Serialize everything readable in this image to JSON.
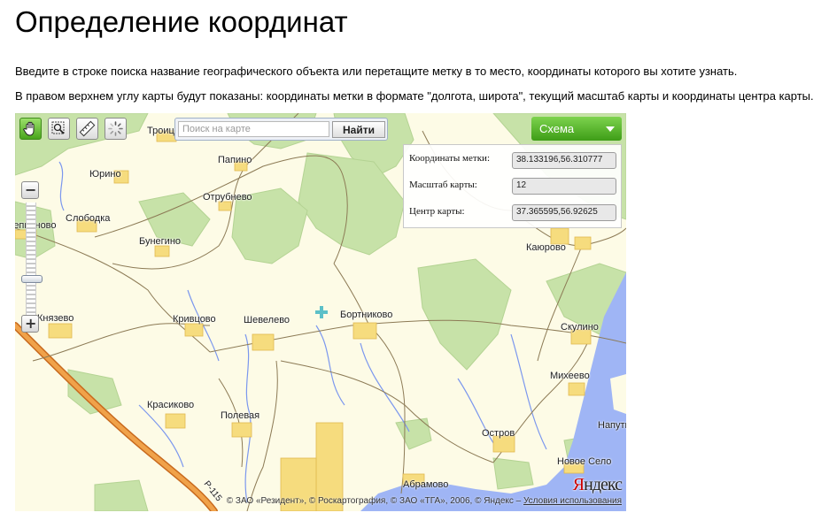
{
  "page": {
    "title": "Определение координат",
    "intro_1": "Введите в строке поиска название географического объекта или перетащите метку в то место, координаты которого вы хотите узнать.",
    "intro_2": "В правом верхнем углу карты будут показаны: координаты метки в формате \"долгота, широта\", текущий масштаб карты и координаты центра карты."
  },
  "toolbar": {
    "tools": [
      {
        "name": "hand-pan-icon",
        "active": true
      },
      {
        "name": "zoom-area-icon",
        "active": false
      },
      {
        "name": "ruler-icon",
        "active": false
      },
      {
        "name": "loading-spinner-icon",
        "active": false
      }
    ],
    "search_placeholder": "Поиск на карте",
    "search_button": "Найти",
    "layer_label": "Схема"
  },
  "info": {
    "marker_label": "Координаты метки:",
    "marker_value": "38.133196,56.310777",
    "scale_label": "Масштаб карты:",
    "scale_value": "12",
    "center_label": "Центр карты:",
    "center_value": "37.365595,56.92625"
  },
  "map": {
    "places": [
      "Троицкое",
      "Папино",
      "Юрино",
      "Отрубнево",
      "Слободка",
      "Щеппиново",
      "Бунегино",
      "Каюрово",
      "Бортниково",
      "Князево",
      "Кривцово",
      "Шевелево",
      "Скулино",
      "Михеево",
      "Красиково",
      "Полевая",
      "Остров",
      "Абрамово",
      "Новое Село",
      "Напутное"
    ],
    "road_label": "Р-115",
    "copyright_text": "© ЗАО «Резидент», © Роскартография, © ЗАО «ТГА», 2006, © Яндекс –",
    "terms_link": "Условия использования",
    "logo_red": "Я",
    "logo_rest": "ндекс",
    "colors": {
      "land": "#fdfbe6",
      "forest": "#c7e2a8",
      "water": "#9fb5f5",
      "settlement": "#f6dc7e",
      "highway": "#e8a040"
    }
  }
}
